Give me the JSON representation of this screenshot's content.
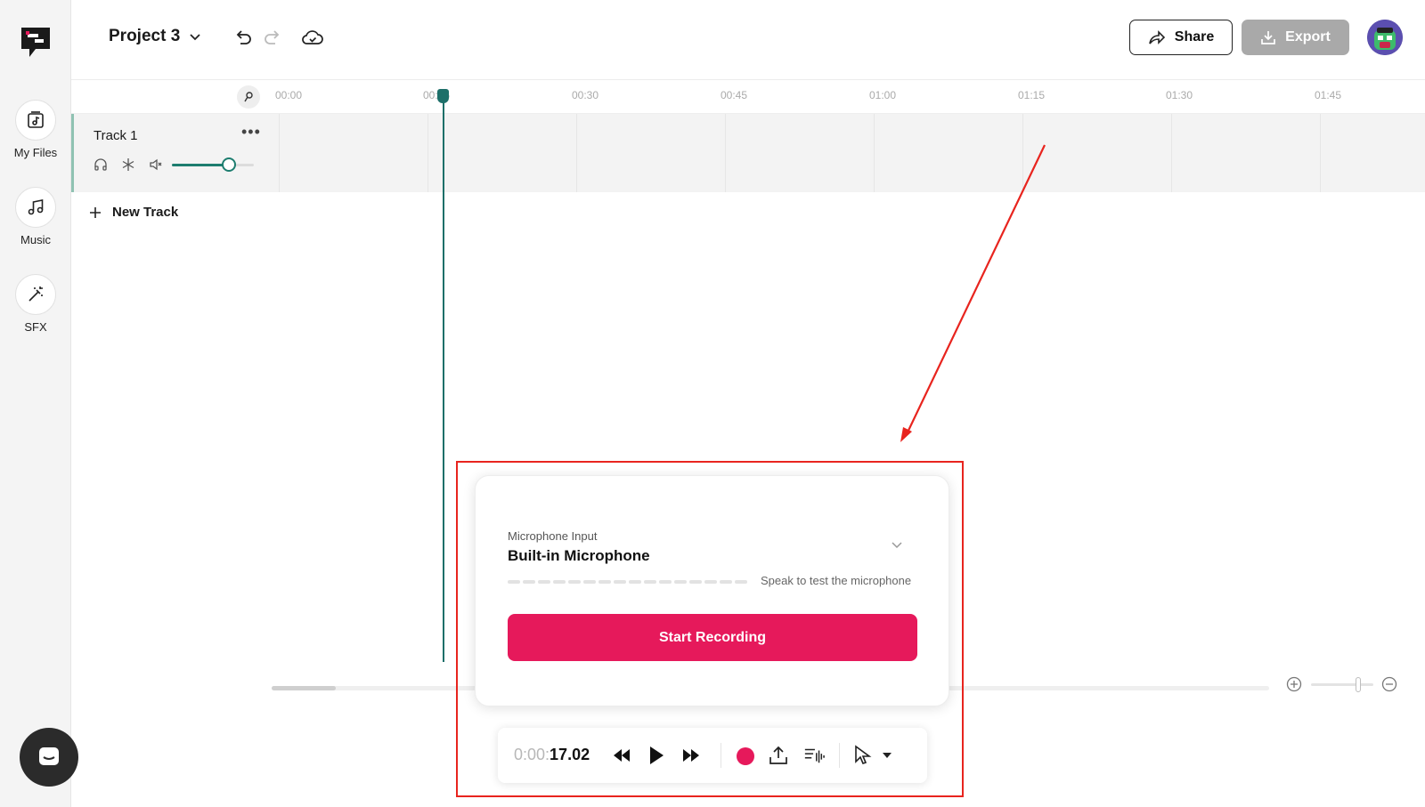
{
  "sidebar": {
    "items": [
      {
        "label": "My Files",
        "icon": "music-file-icon"
      },
      {
        "label": "Music",
        "icon": "music-note-icon"
      },
      {
        "label": "SFX",
        "icon": "magic-wand-icon"
      }
    ],
    "chat_icon": "chat-icon"
  },
  "header": {
    "project_title": "Project 3",
    "share_label": "Share",
    "export_label": "Export"
  },
  "timeline": {
    "ticks": [
      "00:00",
      "00:15",
      "00:30",
      "00:45",
      "01:00",
      "01:15",
      "01:30",
      "01:45"
    ],
    "playhead_seconds": 17.02
  },
  "tracks": [
    {
      "name": "Track 1",
      "volume_percent": 70
    }
  ],
  "new_track_label": "New Track",
  "record_panel": {
    "mic_label": "Microphone Input",
    "mic_value": "Built-in Microphone",
    "meter_hint": "Speak to test the microphone",
    "start_label": "Start Recording"
  },
  "transport": {
    "time_prefix": "0:00:",
    "time_main": "17.02"
  },
  "colors": {
    "accent": "#e6195b",
    "teal": "#1d6f69",
    "annotation": "#e8241e"
  }
}
